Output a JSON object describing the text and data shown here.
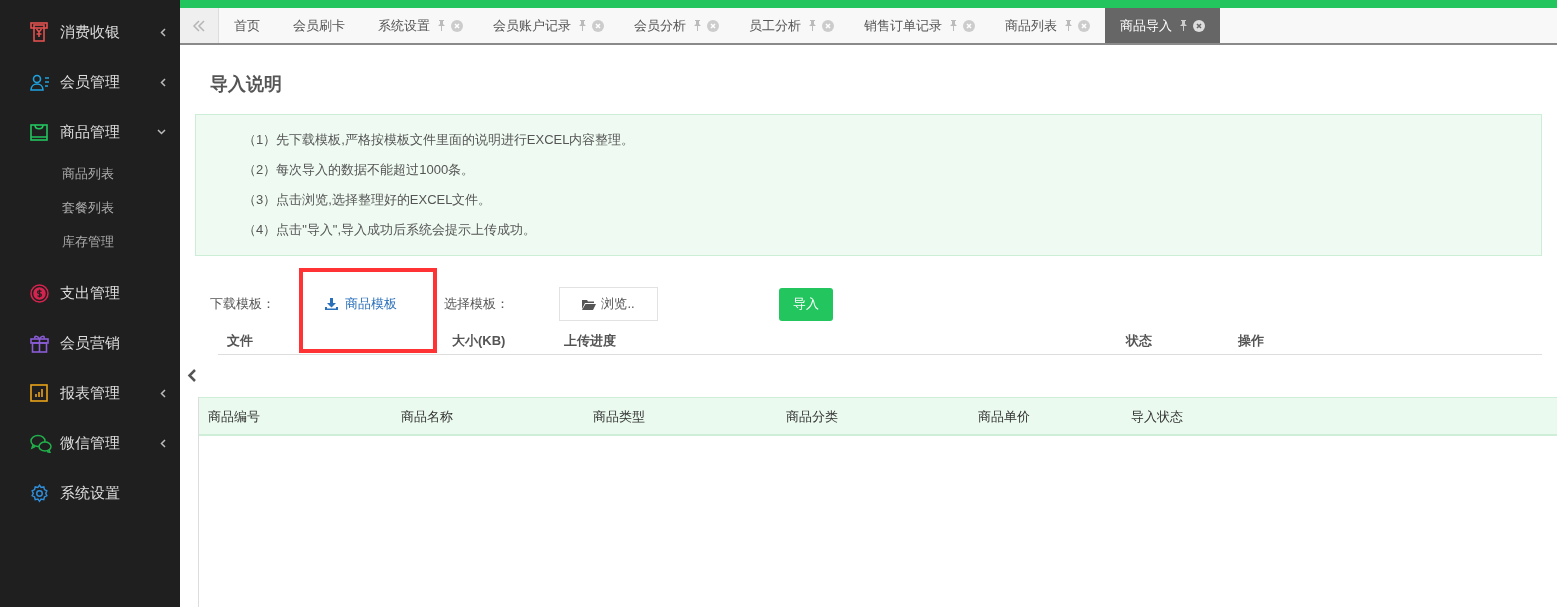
{
  "sidebar": {
    "items": [
      {
        "kind": "group",
        "label": "消费收银",
        "expanded": false
      },
      {
        "kind": "group",
        "label": "会员管理",
        "expanded": false
      },
      {
        "kind": "group",
        "label": "商品管理",
        "expanded": true,
        "children": [
          {
            "label": "商品列表"
          },
          {
            "label": "套餐列表"
          },
          {
            "label": "库存管理"
          }
        ]
      },
      {
        "kind": "link",
        "label": "支出管理"
      },
      {
        "kind": "link",
        "label": "会员营销"
      },
      {
        "kind": "group",
        "label": "报表管理",
        "expanded": false
      },
      {
        "kind": "group",
        "label": "微信管理",
        "expanded": false
      },
      {
        "kind": "link",
        "label": "系统设置"
      }
    ]
  },
  "tabs": [
    {
      "label": "首页",
      "closable": false,
      "selected": false
    },
    {
      "label": "会员刷卡",
      "closable": false,
      "selected": false
    },
    {
      "label": "系统设置",
      "closable": true,
      "selected": false
    },
    {
      "label": "会员账户记录",
      "closable": true,
      "selected": false
    },
    {
      "label": "会员分析",
      "closable": true,
      "selected": false
    },
    {
      "label": "员工分析",
      "closable": true,
      "selected": false
    },
    {
      "label": "销售订单记录",
      "closable": true,
      "selected": false
    },
    {
      "label": "商品列表",
      "closable": true,
      "selected": false
    },
    {
      "label": "商品导入",
      "closable": true,
      "selected": true
    }
  ],
  "title": "导入说明",
  "instructions": [
    "（1）先下载模板,严格按模板文件里面的说明进行EXCEL内容整理。",
    "（2）每次导入的数据不能超过1000条。",
    "（3）点击浏览,选择整理好的EXCEL文件。",
    "（4）点击\"导入\",导入成功后系统会提示上传成功。"
  ],
  "download_label": "下载模板：",
  "download_link": "商品模板",
  "choose_label": "选择模板：",
  "browse_button": "浏览..",
  "import_button": "导入",
  "upload_columns": [
    "文件",
    "大小(KB)",
    "上传进度",
    "状态",
    "操作"
  ],
  "grid_columns": [
    "商品编号",
    "商品名称",
    "商品类型",
    "商品分类",
    "商品单价",
    "导入状态"
  ]
}
